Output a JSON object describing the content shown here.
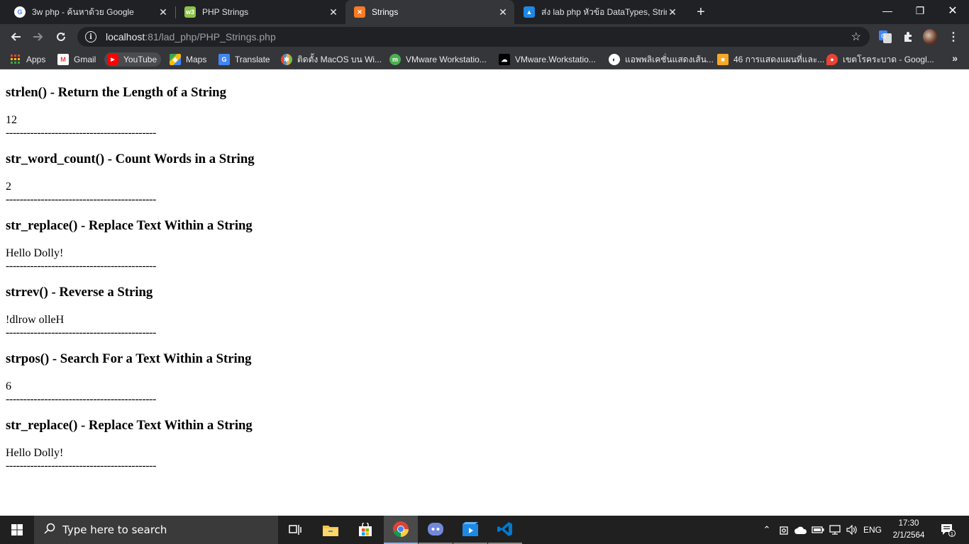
{
  "tabs": [
    {
      "title": "3w php - ค้นหาด้วย Google",
      "icon": "google-icon"
    },
    {
      "title": "PHP Strings",
      "icon": "w3schools-icon"
    },
    {
      "title": "Strings",
      "icon": "xampp-icon"
    },
    {
      "title": "ส่ง lab php หัวข้อ DataTypes, Strings",
      "icon": "classroom-icon"
    }
  ],
  "address": {
    "host": "localhost",
    "rest": ":81/lad_php/PHP_Strings.php"
  },
  "bookmarks": [
    {
      "label": "Apps",
      "icon": "apps-grid-icon"
    },
    {
      "label": "Gmail",
      "icon": "gmail-icon"
    },
    {
      "label": "YouTube",
      "icon": "youtube-icon"
    },
    {
      "label": "Maps",
      "icon": "maps-icon"
    },
    {
      "label": "Translate",
      "icon": "translate-icon"
    },
    {
      "label": "ติดตั้ง MacOS บน Wi...",
      "icon": "joomla-icon"
    },
    {
      "label": "VMware Workstatio...",
      "icon": "vmware-icon"
    },
    {
      "label": "VMware.Workstatio...",
      "icon": "cloud-download-icon"
    },
    {
      "label": "แอพพลิเคชั่นแสดงเส้น...",
      "icon": "globe-icon"
    },
    {
      "label": "46 การแสดงแผนที่และ...",
      "icon": "folder-orange-icon"
    },
    {
      "label": "เขตโรคระบาด - Googl...",
      "icon": "map-pin-icon"
    }
  ],
  "sections": [
    {
      "heading": "strlen() - Return the Length of a String",
      "output": "12",
      "separator": "-------------------------------------------"
    },
    {
      "heading": "str_word_count() - Count Words in a String",
      "output": "2",
      "separator": "-------------------------------------------"
    },
    {
      "heading": "str_replace() - Replace Text Within a String",
      "output": "Hello Dolly!",
      "separator": "-------------------------------------------"
    },
    {
      "heading": "strrev() - Reverse a String",
      "output": "!dlrow olleH",
      "separator": "-------------------------------------------"
    },
    {
      "heading": "strpos() - Search For a Text Within a String",
      "output": "6",
      "separator": "-------------------------------------------"
    },
    {
      "heading": "str_replace() - Replace Text Within a String",
      "output": "Hello Dolly!",
      "separator": "-------------------------------------------"
    }
  ],
  "taskbar": {
    "search_placeholder": "Type here to search",
    "language": "ENG",
    "time": "17:30",
    "date": "2/1/2564",
    "notification_count": "1"
  }
}
